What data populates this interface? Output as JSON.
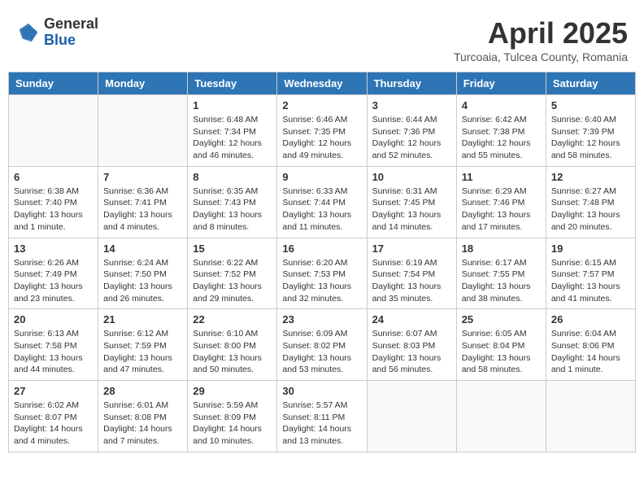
{
  "logo": {
    "general": "General",
    "blue": "Blue"
  },
  "title": "April 2025",
  "subtitle": "Turcoaia, Tulcea County, Romania",
  "weekdays": [
    "Sunday",
    "Monday",
    "Tuesday",
    "Wednesday",
    "Thursday",
    "Friday",
    "Saturday"
  ],
  "weeks": [
    [
      {
        "day": "",
        "info": ""
      },
      {
        "day": "",
        "info": ""
      },
      {
        "day": "1",
        "info": "Sunrise: 6:48 AM\nSunset: 7:34 PM\nDaylight: 12 hours and 46 minutes."
      },
      {
        "day": "2",
        "info": "Sunrise: 6:46 AM\nSunset: 7:35 PM\nDaylight: 12 hours and 49 minutes."
      },
      {
        "day": "3",
        "info": "Sunrise: 6:44 AM\nSunset: 7:36 PM\nDaylight: 12 hours and 52 minutes."
      },
      {
        "day": "4",
        "info": "Sunrise: 6:42 AM\nSunset: 7:38 PM\nDaylight: 12 hours and 55 minutes."
      },
      {
        "day": "5",
        "info": "Sunrise: 6:40 AM\nSunset: 7:39 PM\nDaylight: 12 hours and 58 minutes."
      }
    ],
    [
      {
        "day": "6",
        "info": "Sunrise: 6:38 AM\nSunset: 7:40 PM\nDaylight: 13 hours and 1 minute."
      },
      {
        "day": "7",
        "info": "Sunrise: 6:36 AM\nSunset: 7:41 PM\nDaylight: 13 hours and 4 minutes."
      },
      {
        "day": "8",
        "info": "Sunrise: 6:35 AM\nSunset: 7:43 PM\nDaylight: 13 hours and 8 minutes."
      },
      {
        "day": "9",
        "info": "Sunrise: 6:33 AM\nSunset: 7:44 PM\nDaylight: 13 hours and 11 minutes."
      },
      {
        "day": "10",
        "info": "Sunrise: 6:31 AM\nSunset: 7:45 PM\nDaylight: 13 hours and 14 minutes."
      },
      {
        "day": "11",
        "info": "Sunrise: 6:29 AM\nSunset: 7:46 PM\nDaylight: 13 hours and 17 minutes."
      },
      {
        "day": "12",
        "info": "Sunrise: 6:27 AM\nSunset: 7:48 PM\nDaylight: 13 hours and 20 minutes."
      }
    ],
    [
      {
        "day": "13",
        "info": "Sunrise: 6:26 AM\nSunset: 7:49 PM\nDaylight: 13 hours and 23 minutes."
      },
      {
        "day": "14",
        "info": "Sunrise: 6:24 AM\nSunset: 7:50 PM\nDaylight: 13 hours and 26 minutes."
      },
      {
        "day": "15",
        "info": "Sunrise: 6:22 AM\nSunset: 7:52 PM\nDaylight: 13 hours and 29 minutes."
      },
      {
        "day": "16",
        "info": "Sunrise: 6:20 AM\nSunset: 7:53 PM\nDaylight: 13 hours and 32 minutes."
      },
      {
        "day": "17",
        "info": "Sunrise: 6:19 AM\nSunset: 7:54 PM\nDaylight: 13 hours and 35 minutes."
      },
      {
        "day": "18",
        "info": "Sunrise: 6:17 AM\nSunset: 7:55 PM\nDaylight: 13 hours and 38 minutes."
      },
      {
        "day": "19",
        "info": "Sunrise: 6:15 AM\nSunset: 7:57 PM\nDaylight: 13 hours and 41 minutes."
      }
    ],
    [
      {
        "day": "20",
        "info": "Sunrise: 6:13 AM\nSunset: 7:58 PM\nDaylight: 13 hours and 44 minutes."
      },
      {
        "day": "21",
        "info": "Sunrise: 6:12 AM\nSunset: 7:59 PM\nDaylight: 13 hours and 47 minutes."
      },
      {
        "day": "22",
        "info": "Sunrise: 6:10 AM\nSunset: 8:00 PM\nDaylight: 13 hours and 50 minutes."
      },
      {
        "day": "23",
        "info": "Sunrise: 6:09 AM\nSunset: 8:02 PM\nDaylight: 13 hours and 53 minutes."
      },
      {
        "day": "24",
        "info": "Sunrise: 6:07 AM\nSunset: 8:03 PM\nDaylight: 13 hours and 56 minutes."
      },
      {
        "day": "25",
        "info": "Sunrise: 6:05 AM\nSunset: 8:04 PM\nDaylight: 13 hours and 58 minutes."
      },
      {
        "day": "26",
        "info": "Sunrise: 6:04 AM\nSunset: 8:06 PM\nDaylight: 14 hours and 1 minute."
      }
    ],
    [
      {
        "day": "27",
        "info": "Sunrise: 6:02 AM\nSunset: 8:07 PM\nDaylight: 14 hours and 4 minutes."
      },
      {
        "day": "28",
        "info": "Sunrise: 6:01 AM\nSunset: 8:08 PM\nDaylight: 14 hours and 7 minutes."
      },
      {
        "day": "29",
        "info": "Sunrise: 5:59 AM\nSunset: 8:09 PM\nDaylight: 14 hours and 10 minutes."
      },
      {
        "day": "30",
        "info": "Sunrise: 5:57 AM\nSunset: 8:11 PM\nDaylight: 14 hours and 13 minutes."
      },
      {
        "day": "",
        "info": ""
      },
      {
        "day": "",
        "info": ""
      },
      {
        "day": "",
        "info": ""
      }
    ]
  ]
}
